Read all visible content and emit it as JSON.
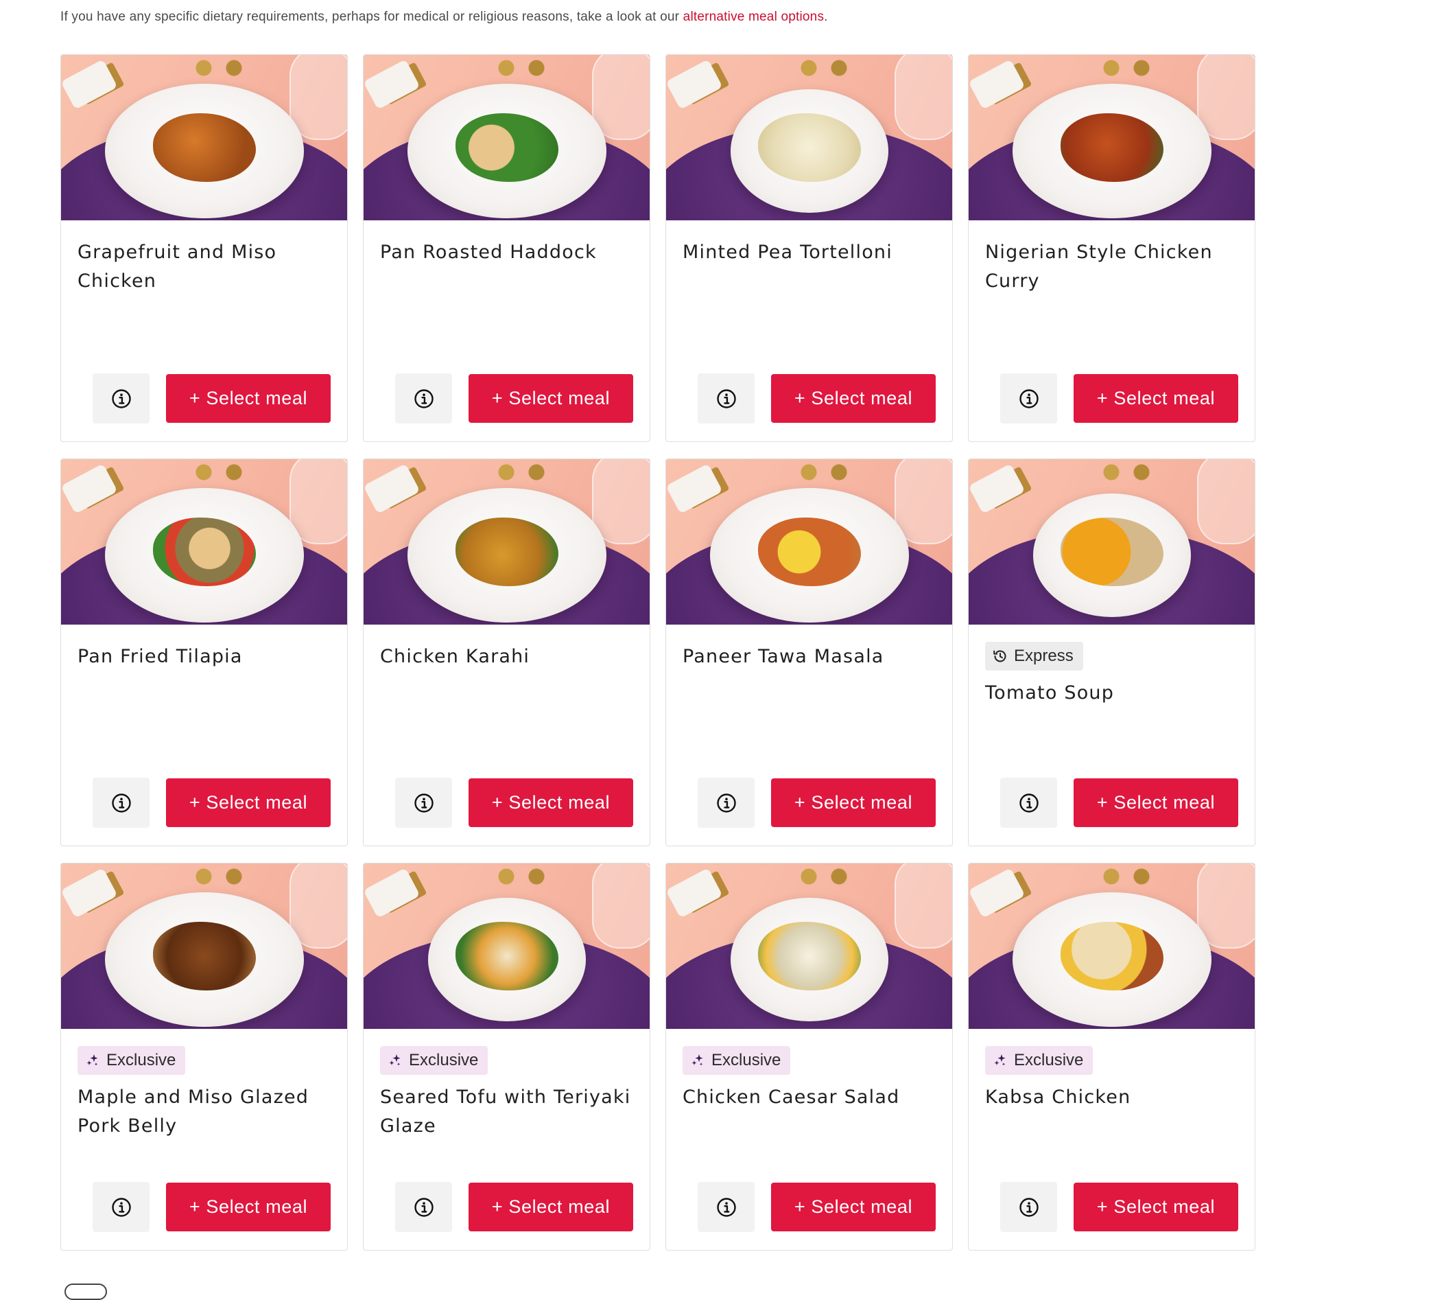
{
  "intro": {
    "text": "If you have any specific dietary requirements, perhaps for medical or religious reasons, take a look at our ",
    "link": "alternative meal options",
    "suffix": "."
  },
  "colors": {
    "accent": "#e0173f",
    "link": "#c8102e",
    "express_badge_bg": "#ececec",
    "exclusive_badge_bg": "#f4e3f3"
  },
  "meals": [
    {
      "name": "Grapefruit and Miso Chicken",
      "badge": "",
      "select_label": "+ Select meal",
      "info_icon": "info-icon"
    },
    {
      "name": "Pan Roasted Haddock",
      "badge": "",
      "select_label": "+ Select meal",
      "info_icon": "info-icon"
    },
    {
      "name": "Minted Pea Tortelloni",
      "badge": "",
      "select_label": "+ Select meal",
      "info_icon": "info-icon"
    },
    {
      "name": "Nigerian Style Chicken Curry",
      "badge": "",
      "select_label": "+ Select meal",
      "info_icon": "info-icon"
    },
    {
      "name": "Pan Fried Tilapia",
      "badge": "",
      "select_label": "+ Select meal",
      "info_icon": "info-icon"
    },
    {
      "name": "Chicken Karahi",
      "badge": "",
      "select_label": "+ Select meal",
      "info_icon": "info-icon"
    },
    {
      "name": "Paneer Tawa Masala",
      "badge": "",
      "select_label": "+ Select meal",
      "info_icon": "info-icon"
    },
    {
      "name": "Tomato Soup",
      "badge": "Express",
      "badge_icon": "clock-history-icon",
      "select_label": "+ Select meal",
      "info_icon": "info-icon"
    },
    {
      "name": "Maple and Miso Glazed Pork Belly",
      "badge": "Exclusive",
      "badge_icon": "sparkles-icon",
      "select_label": "+ Select meal",
      "info_icon": "info-icon"
    },
    {
      "name": "Seared Tofu with Teriyaki Glaze",
      "badge": "Exclusive",
      "badge_icon": "sparkles-icon",
      "select_label": "+ Select meal",
      "info_icon": "info-icon"
    },
    {
      "name": "Chicken Caesar Salad",
      "badge": "Exclusive",
      "badge_icon": "sparkles-icon",
      "select_label": "+ Select meal",
      "info_icon": "info-icon"
    },
    {
      "name": "Kabsa Chicken",
      "badge": "Exclusive",
      "badge_icon": "sparkles-icon",
      "select_label": "+ Select meal",
      "info_icon": "info-icon"
    }
  ]
}
